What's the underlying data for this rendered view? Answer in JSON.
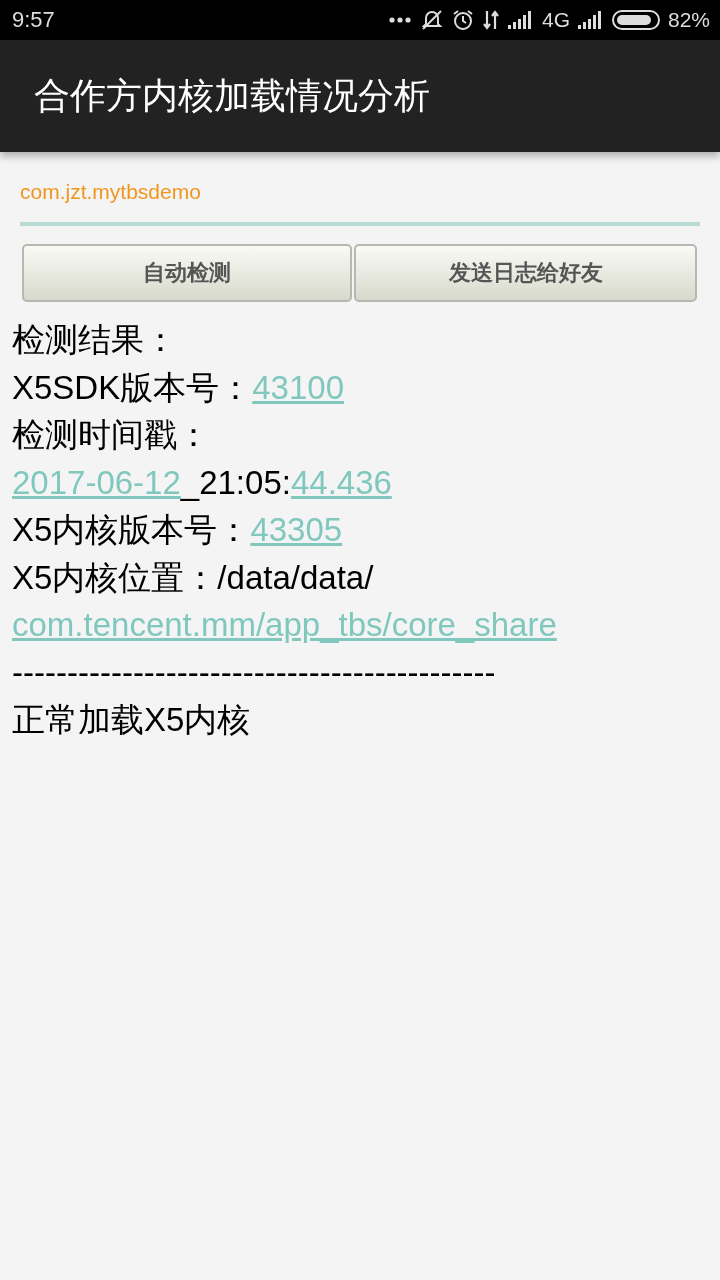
{
  "status_bar": {
    "time": "9:57",
    "network": "4G",
    "battery": "82%"
  },
  "app_bar": {
    "title": "合作方内核加载情况分析"
  },
  "package_field": {
    "value": "com.jzt.mytbsdemo"
  },
  "buttons": [
    "自动检测",
    "发送日志给好友"
  ],
  "result_lines": [
    [
      {
        "text": "检测结果：",
        "link": false
      }
    ],
    [
      {
        "text": "X5SDK版本号：",
        "link": false
      },
      {
        "text": "43100",
        "link": true
      }
    ],
    [
      {
        "text": "检测时间戳：",
        "link": false
      }
    ],
    [
      {
        "text": "2017-06-12",
        "link": true
      },
      {
        "text": "_21:05:",
        "link": false
      },
      {
        "text": "44.436",
        "link": true
      }
    ],
    [
      {
        "text": "X5内核版本号：",
        "link": false
      },
      {
        "text": "43305",
        "link": true
      }
    ],
    [
      {
        "text": "X5内核位置：/data/data/",
        "link": false
      }
    ],
    [
      {
        "text": "com.tencent.mm/app_tbs/core_share",
        "link": true
      }
    ],
    [
      {
        "text": "--------------------------------------------",
        "link": false
      }
    ],
    [
      {
        "text": "正常加载X5内核",
        "link": false
      }
    ]
  ]
}
